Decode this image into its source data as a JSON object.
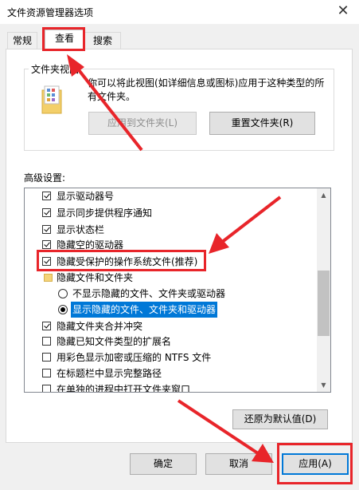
{
  "window": {
    "title": "文件资源管理器选项",
    "close_glyph": "✕"
  },
  "tabs": [
    {
      "label": "常规",
      "active": false
    },
    {
      "label": "查看",
      "active": true
    },
    {
      "label": "搜索",
      "active": false
    }
  ],
  "folder_views": {
    "label": "文件夹视图",
    "description": "你可以将此视图(如详细信息或图标)应用于这种类型的所有文件夹。",
    "apply_button": "应用到文件夹(L)",
    "reset_button": "重置文件夹(R)"
  },
  "advanced": {
    "label": "高级设置:",
    "items": [
      {
        "kind": "checkbox",
        "checked": true,
        "label": "显示驱动器号"
      },
      {
        "kind": "checkbox",
        "checked": true,
        "label": "显示同步提供程序通知"
      },
      {
        "kind": "checkbox",
        "checked": true,
        "label": "显示状态栏"
      },
      {
        "kind": "checkbox",
        "checked": true,
        "label": "隐藏空的驱动器"
      },
      {
        "kind": "checkbox",
        "checked": true,
        "label": "隐藏受保护的操作系统文件(推荐)"
      },
      {
        "kind": "folder",
        "label": "隐藏文件和文件夹"
      },
      {
        "kind": "radio",
        "checked": false,
        "label": "不显示隐藏的文件、文件夹或驱动器"
      },
      {
        "kind": "radio",
        "checked": true,
        "label": "显示隐藏的文件、文件夹和驱动器"
      },
      {
        "kind": "checkbox",
        "checked": true,
        "label": "隐藏文件夹合并冲突"
      },
      {
        "kind": "checkbox",
        "checked": false,
        "label": "隐藏已知文件类型的扩展名"
      },
      {
        "kind": "checkbox",
        "checked": false,
        "label": "用彩色显示加密或压缩的 NTFS 文件"
      },
      {
        "kind": "checkbox",
        "checked": false,
        "label": "在标题栏中显示完整路径"
      },
      {
        "kind": "checkbox",
        "checked": false,
        "label": "在单独的进程中打开文件夹窗口"
      }
    ],
    "restore_button": "还原为默认值(D)"
  },
  "footer": {
    "ok": "确定",
    "cancel": "取消",
    "apply": "应用(A)"
  },
  "colors": {
    "annotation": "#e8252a",
    "selection": "#0078d7"
  }
}
